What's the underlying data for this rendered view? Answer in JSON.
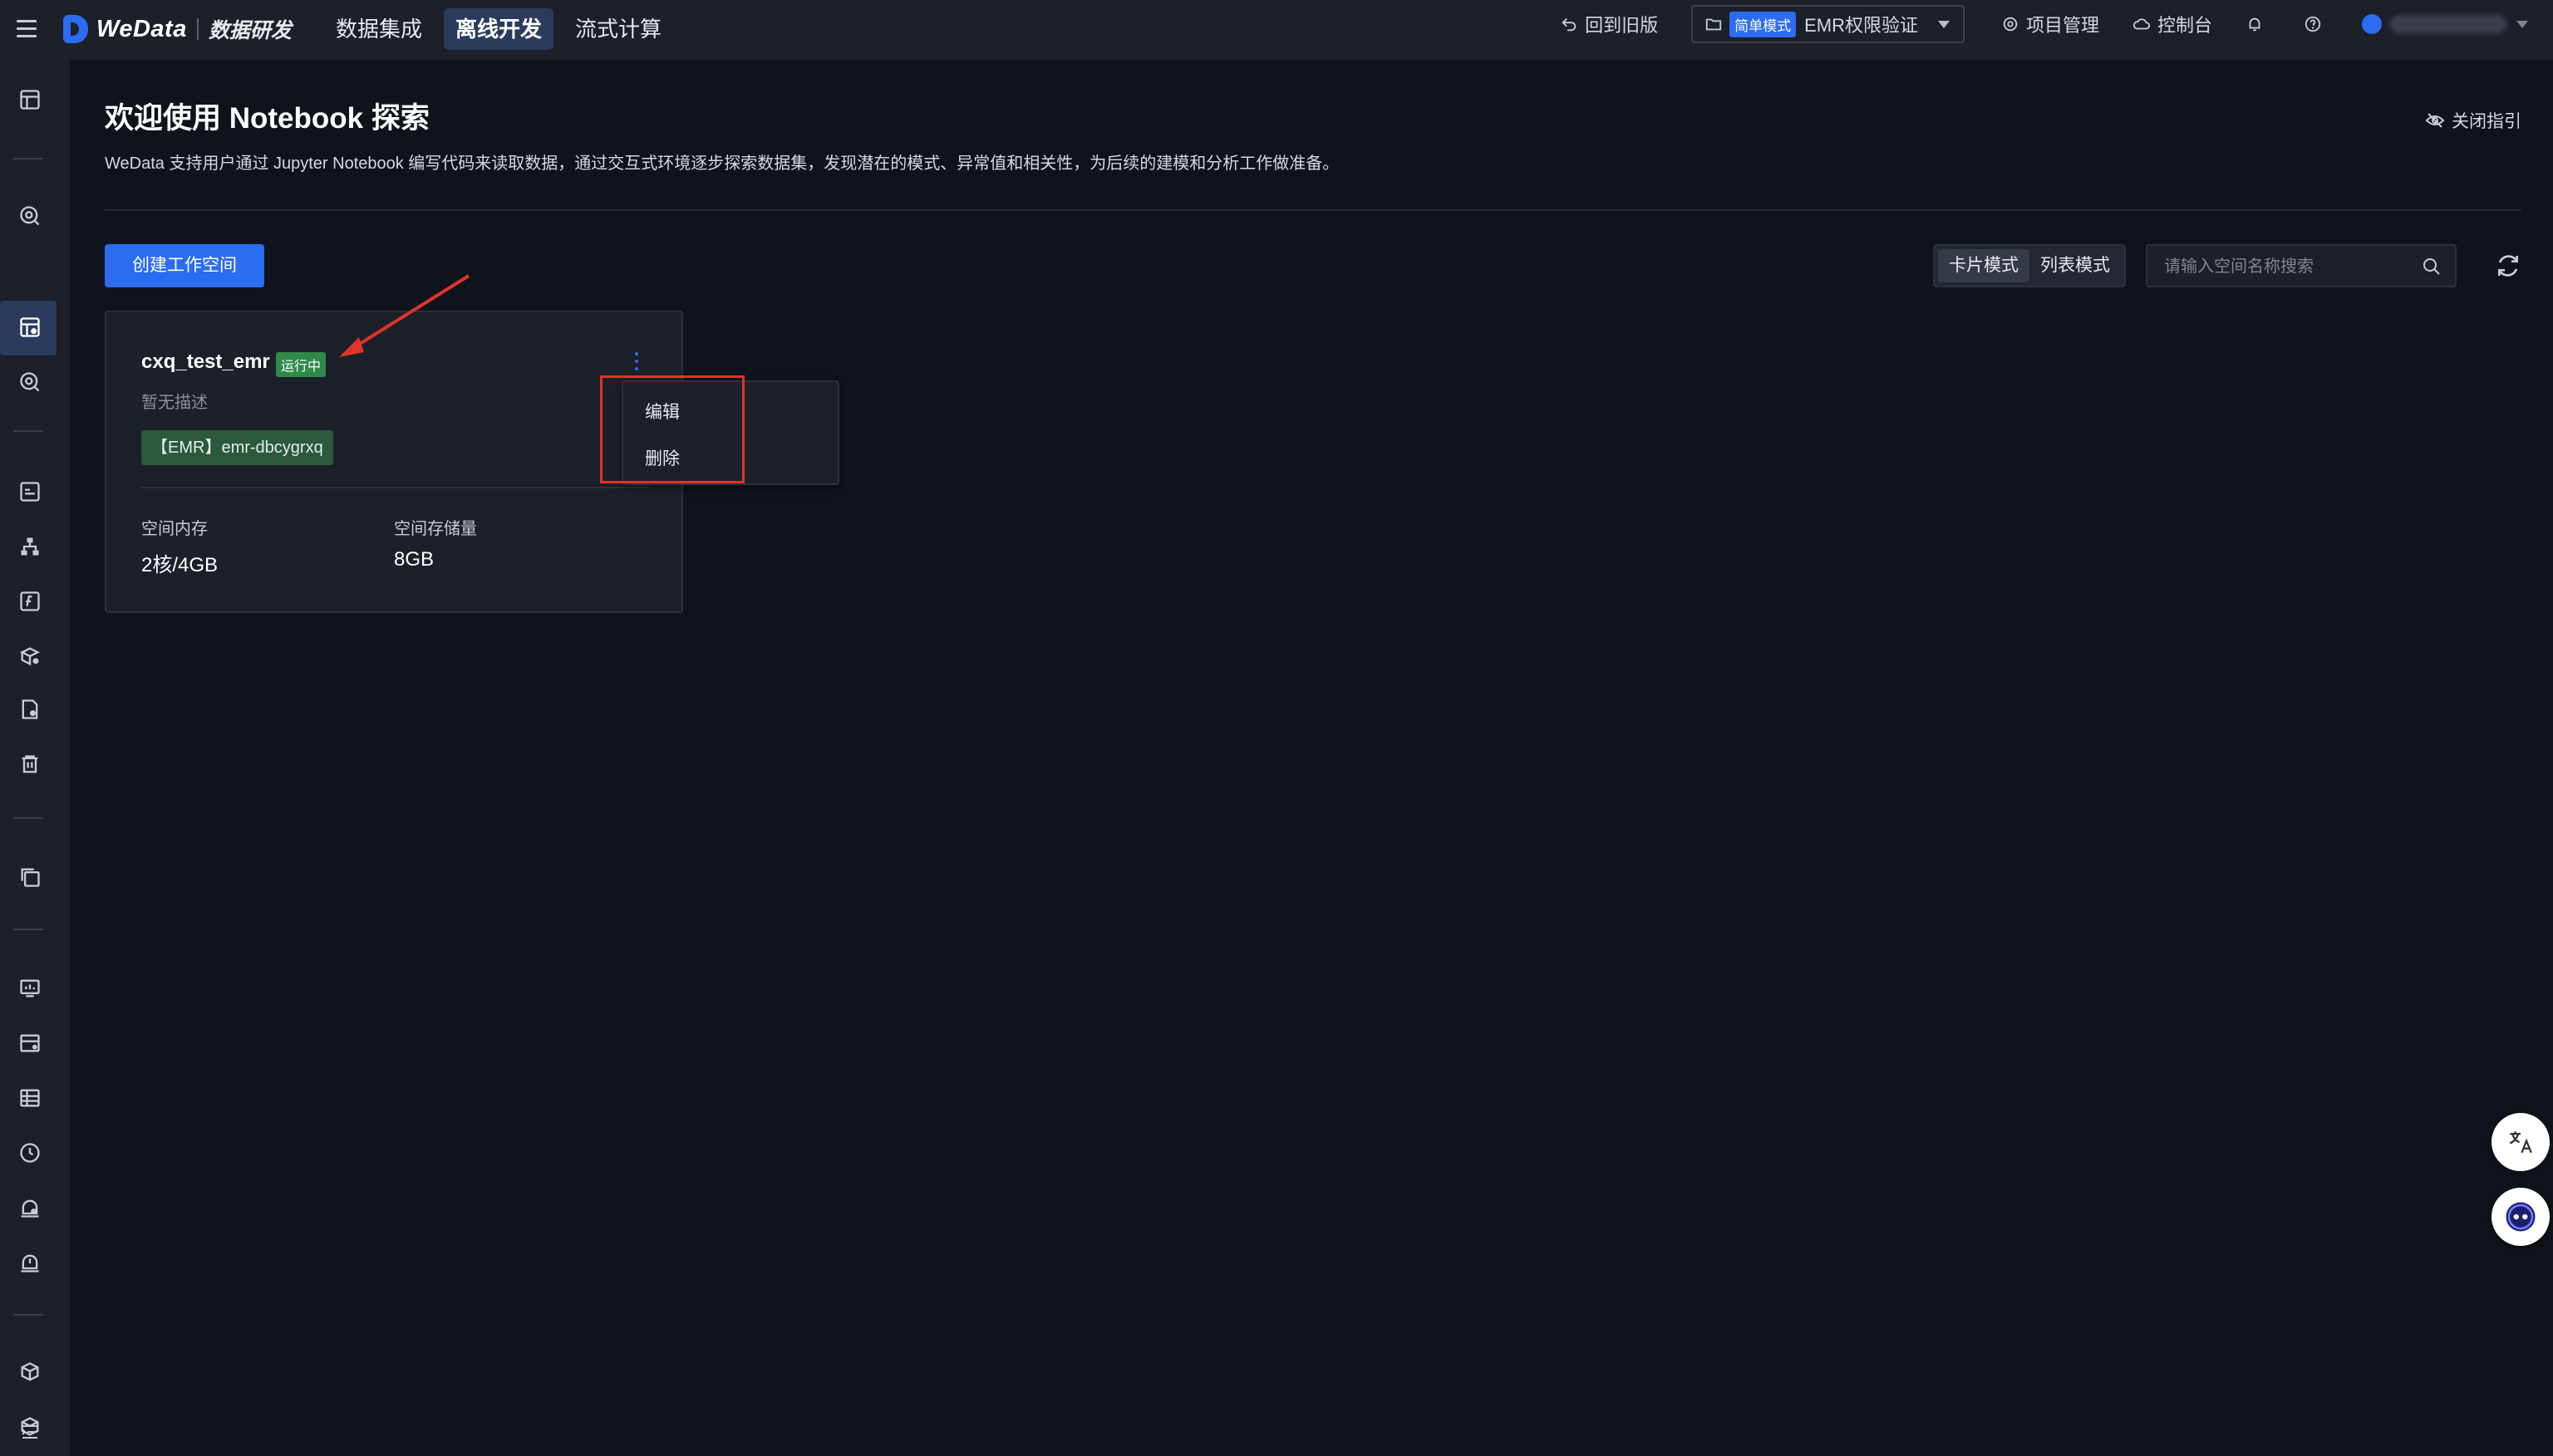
{
  "brand": {
    "name": "WeData",
    "module": "数据研发"
  },
  "main_nav": [
    {
      "label": "数据集成",
      "active": false
    },
    {
      "label": "离线开发",
      "active": true
    },
    {
      "label": "流式计算",
      "active": false
    }
  ],
  "top_right": {
    "back_old": "回到旧版",
    "project_mode_badge": "简单模式",
    "project_name": "EMR权限验证",
    "project_manage": "项目管理",
    "console": "控制台"
  },
  "page": {
    "title": "欢迎使用 Notebook 探索",
    "description": "WeData 支持用户通过 Jupyter Notebook 编写代码来读取数据，通过交互式环境逐步探索数据集，发现潜在的模式、异常值和相关性，为后续的建模和分析工作做准备。",
    "close_guide": "关闭指引"
  },
  "toolbar": {
    "create_workspace": "创建工作空间",
    "view_modes": [
      {
        "label": "卡片模式",
        "active": true
      },
      {
        "label": "列表模式",
        "active": false
      }
    ],
    "search_placeholder": "请输入空间名称搜索"
  },
  "workspace_card": {
    "name": "cxq_test_emr",
    "status": "运行中",
    "description": "暂无描述",
    "tag": "【EMR】emr-dbcygrxq",
    "memory_label": "空间内存",
    "memory_value": "2核/4GB",
    "storage_label": "空间存储量",
    "storage_value": "8GB"
  },
  "context_menu": {
    "items": [
      "编辑",
      "删除"
    ]
  },
  "colors": {
    "accent": "#2b6cf0",
    "background": "#0f131b",
    "panel": "#1c2029",
    "status_running": "#2f8a4a",
    "highlight": "#e0332a"
  }
}
